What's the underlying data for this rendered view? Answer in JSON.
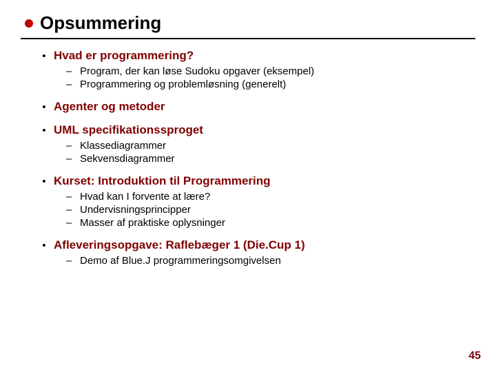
{
  "title": "Opsummering",
  "sections": [
    {
      "heading": "Hvad er programmering?",
      "items": [
        "Program, der kan løse Sudoku opgaver (eksempel)",
        "Programmering og problemløsning (generelt)"
      ]
    },
    {
      "heading": " Agenter og metoder",
      "items": []
    },
    {
      "heading": "UML specifikationssproget",
      "items": [
        "Klassediagrammer",
        "Sekvensdiagrammer"
      ]
    },
    {
      "heading": "Kurset: Introduktion til Programmering",
      "items": [
        "Hvad kan I forvente at lære?",
        "Undervisningsprincipper",
        "Masser af praktiske oplysninger"
      ]
    },
    {
      "heading": "Afleveringsopgave: Raflebæger 1 (Die.Cup 1)",
      "items": [
        "Demo af Blue.J programmeringsomgivelsen"
      ]
    }
  ],
  "page_number": "45",
  "glyphs": {
    "dot": "•",
    "dash": "–"
  }
}
